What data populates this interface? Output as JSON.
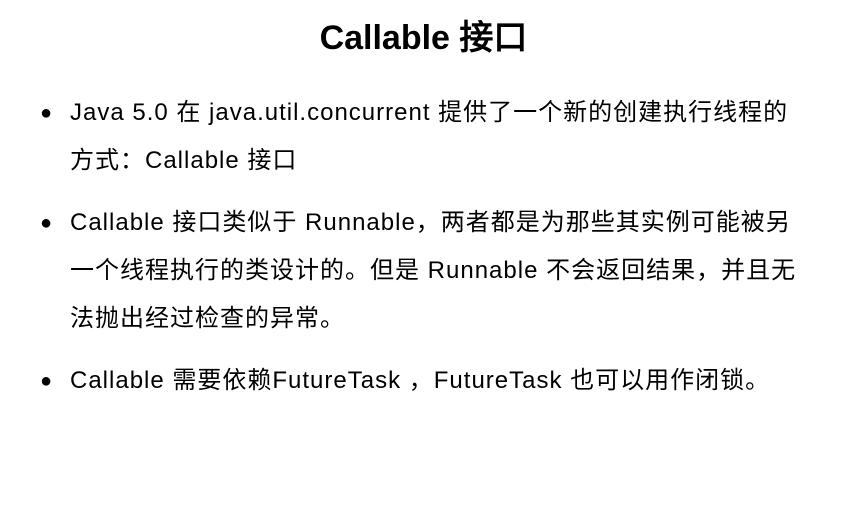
{
  "title": "Callable 接口",
  "bullets": [
    "Java 5.0 在 java.util.concurrent 提供了一个新的创建执行线程的方式：Callable 接口",
    "Callable 接口类似于 Runnable，两者都是为那些其实例可能被另一个线程执行的类设计的。但是 Runnable 不会返回结果，并且无法抛出经过检查的异常。",
    "Callable 需要依赖FutureTask ，FutureTask 也可以用作闭锁。"
  ]
}
